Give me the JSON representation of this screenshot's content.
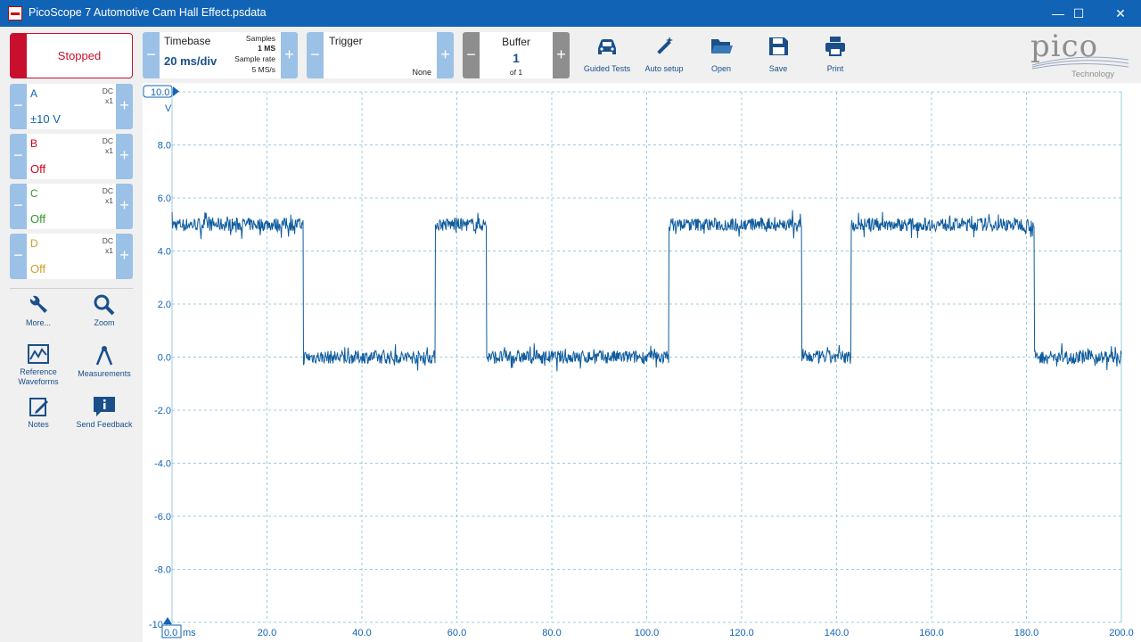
{
  "window": {
    "title": "PicoScope 7 Automotive Cam Hall Effect.psdata",
    "minimize": "—",
    "maximize": "☐",
    "close": "✕"
  },
  "toolbar": {
    "run_label": "Stopped",
    "timebase": {
      "label": "Timebase",
      "value": "20 ms/div",
      "samples_label": "Samples",
      "samples_value": "1 MS",
      "rate_label": "Sample rate",
      "rate_value": "5 MS/s"
    },
    "trigger": {
      "label": "Trigger",
      "mode": "None"
    },
    "buffer": {
      "label": "Buffer",
      "value": "1",
      "of": "of 1"
    },
    "minus": "−",
    "plus": "+",
    "tools": [
      {
        "label": "Guided Tests",
        "icon": "car-icon"
      },
      {
        "label": "Auto setup",
        "icon": "wand-icon"
      },
      {
        "label": "Open",
        "icon": "folder-icon"
      },
      {
        "label": "Save",
        "icon": "save-icon"
      },
      {
        "label": "Print",
        "icon": "print-icon"
      }
    ],
    "logo": {
      "word": "pico",
      "sub": "Technology"
    }
  },
  "channels": [
    {
      "name": "A",
      "coupling": "DC",
      "probe": "x1",
      "range": "±10 V",
      "color": "#1163b5"
    },
    {
      "name": "B",
      "coupling": "DC",
      "probe": "x1",
      "range": "Off",
      "color": "#d0021b"
    },
    {
      "name": "C",
      "coupling": "DC",
      "probe": "x1",
      "range": "Off",
      "color": "#2e9a2e"
    },
    {
      "name": "D",
      "coupling": "DC",
      "probe": "x1",
      "range": "Off",
      "color": "#c9a227"
    }
  ],
  "side_tools": [
    {
      "label": "More...",
      "icon": "wrench-icon"
    },
    {
      "label": "Zoom",
      "icon": "magnifier-icon"
    },
    {
      "label": "Reference Waveforms",
      "icon": "reference-waveform-icon"
    },
    {
      "label": "Measurements",
      "icon": "measurements-icon"
    },
    {
      "label": "Notes",
      "icon": "notes-icon"
    },
    {
      "label": "Send Feedback",
      "icon": "feedback-icon"
    }
  ],
  "scope": {
    "y_unit": "V",
    "y_top_label": "10.0",
    "y_ticks": [
      "8.0",
      "6.0",
      "4.0",
      "2.0",
      "0.0",
      "-2.0",
      "-4.0",
      "-6.0",
      "-8.0"
    ],
    "y_bottom_label": "-10.0",
    "x_unit": "ms",
    "x_first_label": "0.0",
    "x_ticks": [
      "20.0",
      "40.0",
      "60.0",
      "80.0",
      "100.0",
      "120.0",
      "140.0",
      "160.0",
      "180.0",
      "200.0"
    ]
  },
  "chart_data": {
    "type": "line",
    "xlabel": "ms",
    "ylabel": "V",
    "xlim": [
      0,
      200
    ],
    "ylim": [
      -10,
      10
    ],
    "grid": true,
    "series": [
      {
        "values_x": [
          0,
          27.6,
          27.7,
          55.4,
          55.5,
          66.2,
          66.3,
          104.6,
          104.7,
          132.6,
          132.7,
          143.0,
          143.1,
          181.6,
          181.7,
          200
        ],
        "values_y": [
          5.0,
          5.0,
          0.0,
          0.0,
          5.0,
          5.0,
          0.0,
          0.0,
          5.0,
          5.0,
          0.0,
          0.0,
          5.0,
          5.0,
          0.0,
          0.0
        ],
        "noise_pp": 0.5,
        "color": "#0f5c9e"
      }
    ]
  }
}
